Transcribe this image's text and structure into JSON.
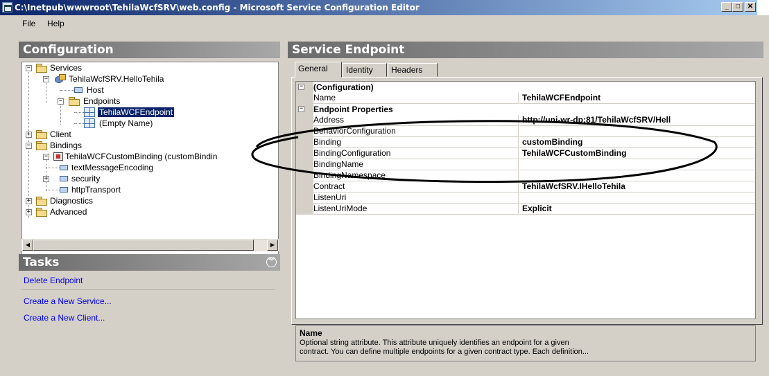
{
  "window": {
    "title": "C:\\Inetpub\\wwwroot\\TehilaWcfSRV\\web.config - Microsoft Service Configuration Editor",
    "minimize": "_",
    "maximize": "□",
    "close": "✕"
  },
  "menu": {
    "file": "File",
    "help": "Help"
  },
  "configuration": {
    "header": "Configuration",
    "tree": {
      "services": "Services",
      "service": "TehilaWcfSRV.HelloTehila",
      "host": "Host",
      "endpoints": "Endpoints",
      "endpoint1": "TehilaWCFEndpoint",
      "endpoint2": "(Empty Name)",
      "client": "Client",
      "bindings": "Bindings",
      "custom_binding": "TehilaWCFCustomBinding (customBindin",
      "text_message_encoding": "textMessageEncoding",
      "security": "security",
      "http_transport": "httpTransport",
      "diagnostics": "Diagnostics",
      "advanced": "Advanced"
    }
  },
  "tasks": {
    "header": "Tasks",
    "delete_endpoint": "Delete Endpoint",
    "create_service": "Create a New Service...",
    "create_client": "Create a New Client..."
  },
  "endpoint": {
    "header": "Service Endpoint",
    "tabs": [
      "General",
      "Identity",
      "Headers"
    ],
    "categories": {
      "configuration": "(Configuration)",
      "endpoint_properties": "Endpoint Properties"
    },
    "properties": [
      {
        "name": "Name",
        "value": "TehilaWCFEndpoint"
      },
      {
        "name": "Address",
        "value": "http://uni-wr-dp:81/TehilaWcfSRV/Hell"
      },
      {
        "name": "BehaviorConfiguration",
        "value": ""
      },
      {
        "name": "Binding",
        "value": "customBinding"
      },
      {
        "name": "BindingConfiguration",
        "value": "TehilaWCFCustomBinding"
      },
      {
        "name": "BindingName",
        "value": ""
      },
      {
        "name": "BindingNamespace",
        "value": ""
      },
      {
        "name": "Contract",
        "value": "TehilaWcfSRV.IHelloTehila"
      },
      {
        "name": "ListenUri",
        "value": ""
      },
      {
        "name": "ListenUriMode",
        "value": "Explicit"
      }
    ],
    "help": {
      "title": "Name",
      "text_line1": "Optional string attribute. This attribute uniquely identifies an endpoint for a given",
      "text_line2": "contract. You can define multiple endpoints for a given contract type. Each definition..."
    }
  },
  "colors": {
    "titlebar_start": "#0a246a",
    "titlebar_end": "#a6caf0",
    "selection": "#0a246a",
    "link": "#0000ee",
    "dialog_bg": "#d4d0c8"
  },
  "icons": {
    "folder": "folder-icon",
    "service": "service-icon",
    "binding": "binding-icon",
    "leaf": "element-icon",
    "endpoint": "endpoint-grid-icon"
  }
}
